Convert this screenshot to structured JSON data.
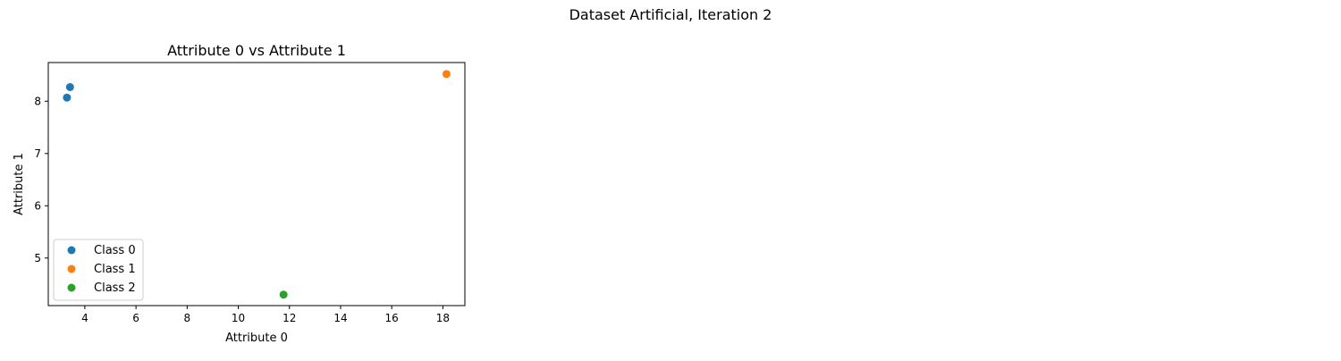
{
  "figure": {
    "suptitle": "Dataset Artificial, Iteration 2"
  },
  "chart_data": {
    "type": "scatter",
    "title": "Attribute 0 vs Attribute 1",
    "xlabel": "Attribute 0",
    "ylabel": "Attribute 1",
    "xlim": [
      2.57,
      18.86
    ],
    "ylim": [
      4.09,
      8.74
    ],
    "xticks": [
      4,
      6,
      8,
      10,
      12,
      14,
      16,
      18
    ],
    "yticks": [
      5,
      6,
      7,
      8
    ],
    "grid": false,
    "legend_position": "lower-left",
    "series": [
      {
        "name": "Class 0",
        "color": "#1f77b4",
        "points": [
          [
            3.3,
            8.07
          ],
          [
            3.42,
            8.27
          ]
        ]
      },
      {
        "name": "Class 1",
        "color": "#ff7f0e",
        "points": [
          [
            18.14,
            8.52
          ]
        ]
      },
      {
        "name": "Class 2",
        "color": "#2ca02c",
        "points": [
          [
            11.77,
            4.3
          ]
        ]
      }
    ]
  }
}
